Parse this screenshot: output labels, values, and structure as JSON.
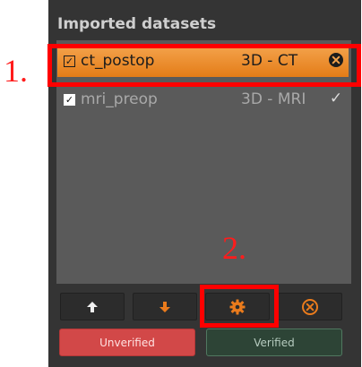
{
  "panel": {
    "title": "Imported datasets",
    "datasets": [
      {
        "name": "ct_postop",
        "type": "3D - CT",
        "checked": true,
        "selected": true,
        "action_icon": "close-circle-icon"
      },
      {
        "name": "mri_preop",
        "type": "3D - MRI",
        "checked": true,
        "selected": false,
        "action_icon": "check-icon"
      }
    ],
    "toolbar": {
      "up_icon": "arrow-up-icon",
      "down_icon": "arrow-down-icon",
      "settings_icon": "gear-icon",
      "remove_icon": "remove-circle-icon"
    },
    "status": {
      "unverified_label": "Unverified",
      "verified_label": "Verified"
    }
  },
  "annotations": {
    "label_1": "1.",
    "label_2": "2."
  },
  "colors": {
    "highlight": "#ff0000",
    "selected_row": "#e47c17",
    "action_orange": "#ea7b1c",
    "unverified": "#d24848",
    "verified": "#2d4436"
  }
}
